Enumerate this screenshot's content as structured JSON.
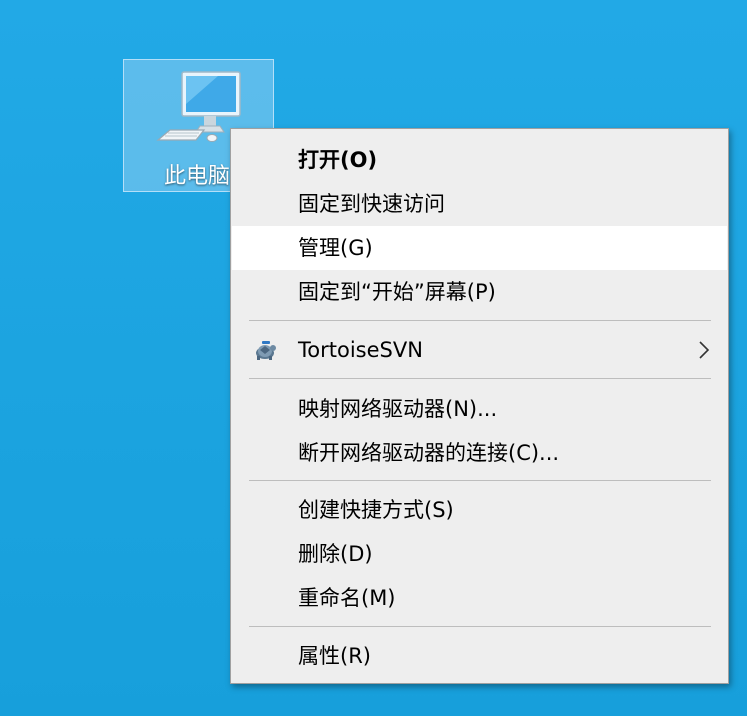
{
  "desktop": {
    "background_color": "#1aa2e0",
    "icon": {
      "label": "此电脑",
      "icon_name": "computer-icon",
      "selected": true
    }
  },
  "context_menu": {
    "hover_color": "#ffffff",
    "items": [
      {
        "label": "打开(O)",
        "bold": true
      },
      {
        "label": "固定到快速访问"
      },
      {
        "label": "管理(G)",
        "hovered": true
      },
      {
        "label": "固定到“开始”屏幕(P)"
      },
      {
        "label": "TortoiseSVN",
        "icon_name": "tortoisesvn-icon",
        "has_submenu": true,
        "submenu_icon": "chevron-right-icon"
      },
      {
        "label": "映射网络驱动器(N)..."
      },
      {
        "label": "断开网络驱动器的连接(C)..."
      },
      {
        "label": "创建快捷方式(S)"
      },
      {
        "label": "删除(D)"
      },
      {
        "label": "重命名(M)"
      },
      {
        "label": "属性(R)"
      }
    ]
  }
}
